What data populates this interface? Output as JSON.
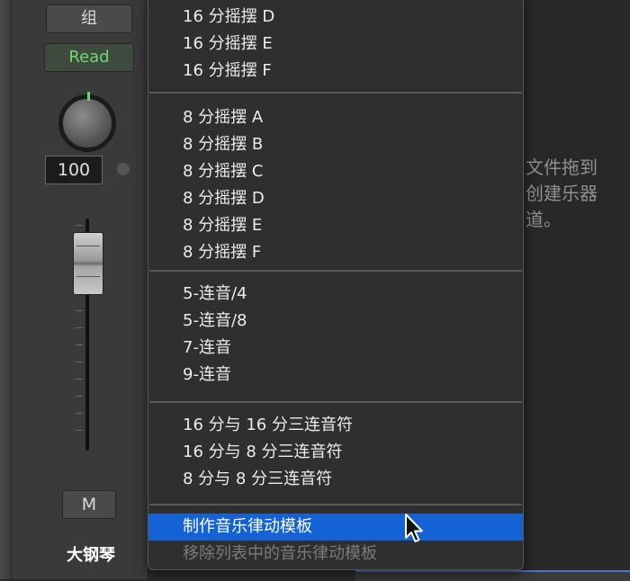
{
  "channel_strip": {
    "group_label": "组",
    "automation_mode": "Read",
    "pan_value": "100",
    "mute_label": "M",
    "track_name": "大钢琴"
  },
  "background_text": "文件拖到\n创建乐器\n道。",
  "menu": {
    "groups": [
      {
        "items": [
          {
            "label": "16 分摇摆 D"
          },
          {
            "label": "16 分摇摆 E"
          },
          {
            "label": "16 分摇摆 F"
          }
        ]
      },
      {
        "items": [
          {
            "label": "8 分摇摆 A"
          },
          {
            "label": "8 分摇摆 B"
          },
          {
            "label": "8 分摇摆 C"
          },
          {
            "label": "8 分摇摆 D"
          },
          {
            "label": "8 分摇摆 E"
          },
          {
            "label": "8 分摇摆 F"
          }
        ]
      },
      {
        "items": [
          {
            "label": "5-连音/4"
          },
          {
            "label": "5-连音/8"
          },
          {
            "label": "7-连音"
          },
          {
            "label": "9-连音"
          }
        ]
      },
      {
        "items": [
          {
            "label": "16 分与 16 分三连音符"
          },
          {
            "label": "16 分与 8 分三连音符"
          },
          {
            "label": "8 分与 8 分三连音符"
          }
        ]
      },
      {
        "items": [
          {
            "label": "制作音乐律动模板",
            "selected": true
          },
          {
            "label": "移除列表中的音乐律动模板",
            "disabled": true
          }
        ]
      }
    ]
  },
  "colors": {
    "selection": "#1462d6",
    "read_mode": "#6fd96f",
    "knob_indicator": "#4ee07a"
  }
}
